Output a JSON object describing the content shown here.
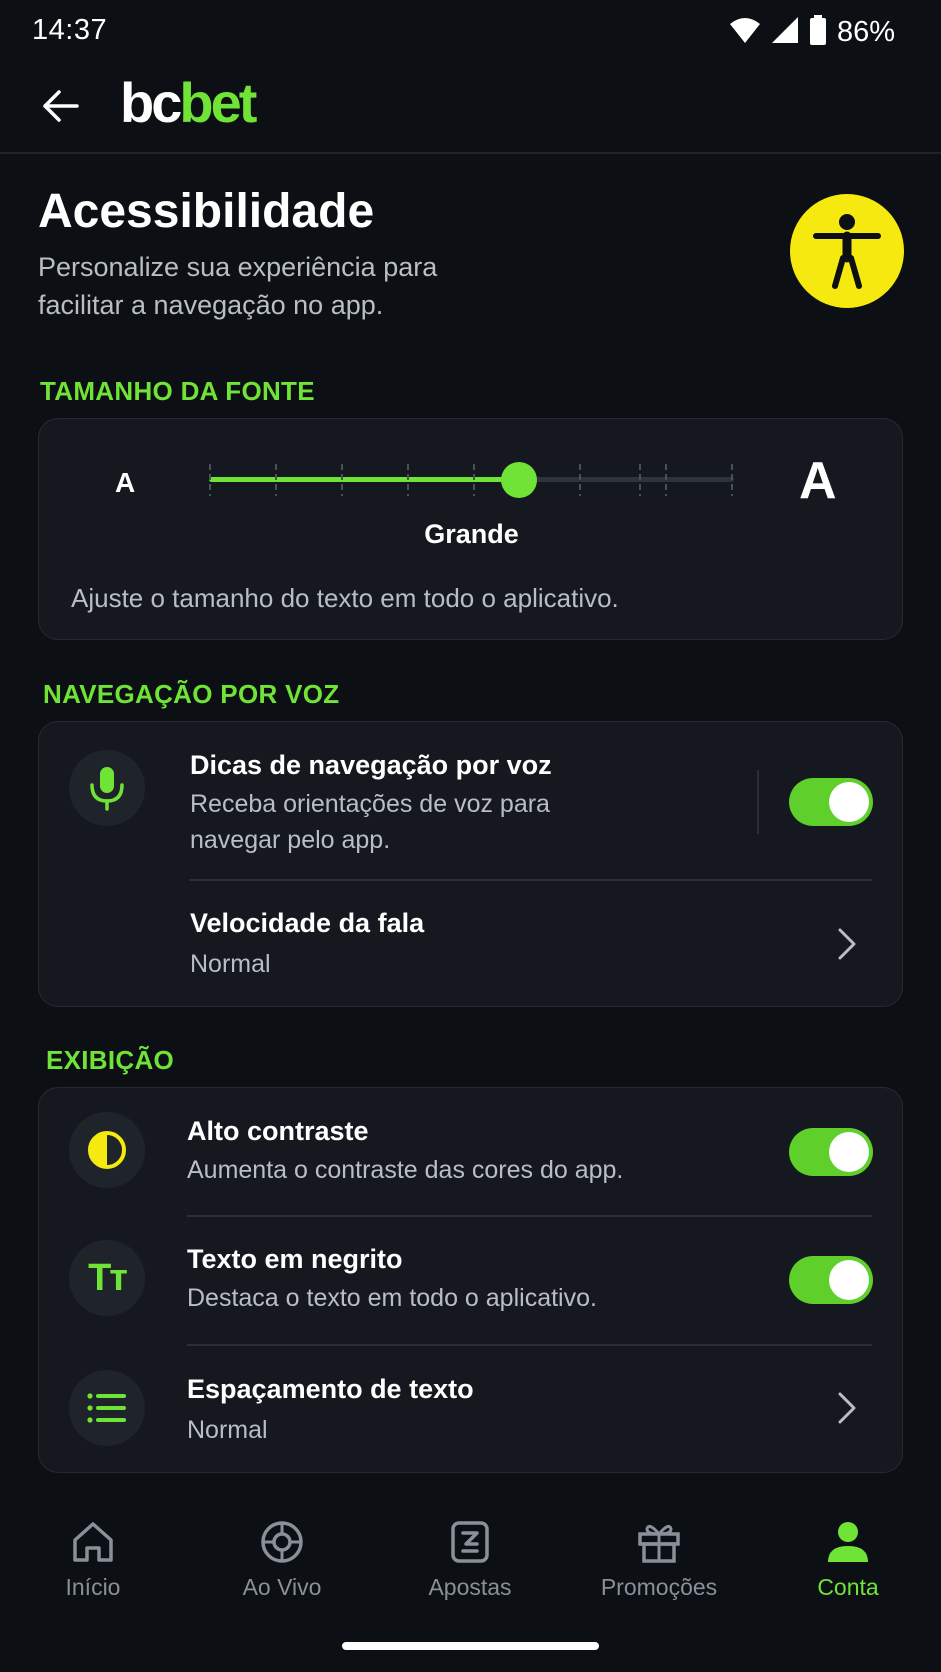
{
  "status_bar": {
    "time": "14:37",
    "battery": "86%"
  },
  "header": {
    "brand_part1": "bc",
    "brand_part2": "bet"
  },
  "page": {
    "title": "Acessibilidade",
    "subtitle": "Personalize sua experiência para facilitar a navegação no app."
  },
  "font_size": {
    "section_label": "TAMANHO DA FONTE",
    "small_glyph": "A",
    "large_glyph": "A",
    "current_value": "Grande",
    "level_fraction": 0.59,
    "description": "Ajuste o tamanho do texto em todo o aplicativo."
  },
  "voice": {
    "section_label": "NAVEGAÇÃO POR VOZ",
    "hints_title": "Dicas de navegação por voz",
    "hints_description": "Receba orientações de voz para navegar pelo app.",
    "hints_enabled": true,
    "speed_title": "Velocidade da fala",
    "speed_value": "Normal"
  },
  "display": {
    "section_label": "EXIBIÇÃO",
    "contrast_title": "Alto contraste",
    "contrast_description": "Aumenta o contraste das cores do app.",
    "contrast_enabled": true,
    "bold_title": "Texto em negrito",
    "bold_description": "Destaca o texto em todo o aplicativo.",
    "bold_icon_text": "Tт",
    "bold_enabled": true,
    "spacing_title": "Espaçamento de texto",
    "spacing_value": "Normal"
  },
  "bottom_nav": {
    "items": [
      {
        "label": "Início",
        "icon": "home-icon",
        "active": false
      },
      {
        "label": "Ao Vivo",
        "icon": "live-icon",
        "active": false
      },
      {
        "label": "Apostas",
        "icon": "bets-icon",
        "active": false
      },
      {
        "label": "Promoções",
        "icon": "gift-icon",
        "active": false
      },
      {
        "label": "Conta",
        "icon": "account-icon",
        "active": true
      }
    ]
  },
  "colors": {
    "accent": "#6fe336",
    "background": "#0c0f13",
    "card": "#15191f",
    "badge": "#f5e90f"
  }
}
